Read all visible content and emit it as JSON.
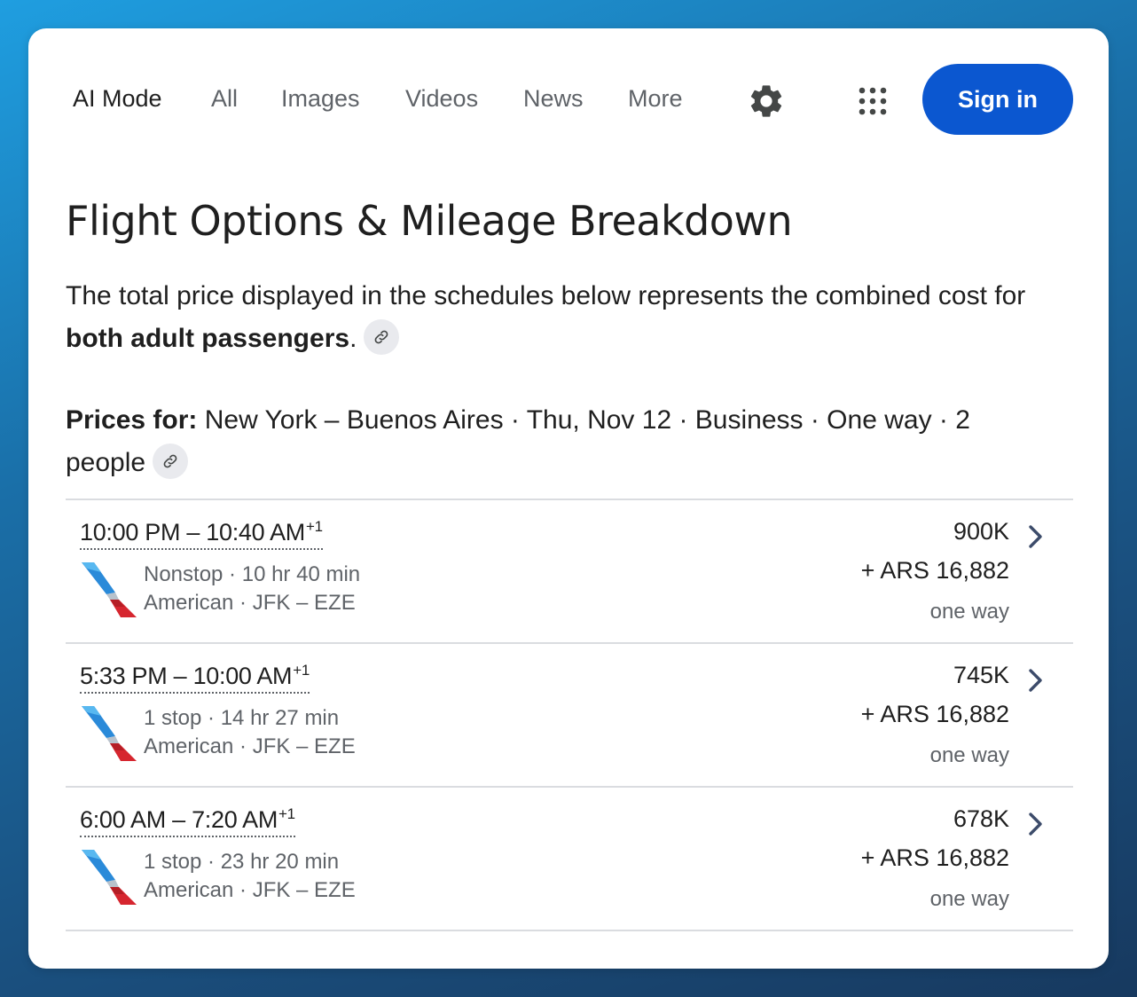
{
  "nav": {
    "items": [
      {
        "label": "AI Mode",
        "active": true
      },
      {
        "label": "All",
        "active": false
      },
      {
        "label": "Images",
        "active": false
      },
      {
        "label": "Videos",
        "active": false
      },
      {
        "label": "News",
        "active": false
      },
      {
        "label": "More",
        "active": false
      }
    ],
    "settings_icon": "gear-icon",
    "apps_icon": "apps-grid-icon",
    "sign_in_label": "Sign in"
  },
  "heading": "Flight Options & Mileage Breakdown",
  "intro": {
    "text_before": "The total price displayed in the schedules below represents the combined cost for ",
    "bold": "both adult passengers",
    "text_after": "."
  },
  "prices_for": {
    "label": "Prices for:",
    "value": " New York – Buenos Aires · Thu, Nov 12 · Business · One way · 2 people"
  },
  "flights": [
    {
      "times": "10:00 PM – 10:40 AM",
      "day_offset": "+1",
      "stops_duration": "Nonstop · 10 hr 40 min",
      "airline_route": "American · JFK – EZE",
      "miles": "900K",
      "fee": "+ ARS 16,882",
      "trip": "one way"
    },
    {
      "times": "5:33 PM – 10:00 AM",
      "day_offset": "+1",
      "stops_duration": "1 stop · 14 hr 27 min",
      "airline_route": "American · JFK – EZE",
      "miles": "745K",
      "fee": "+ ARS 16,882",
      "trip": "one way"
    },
    {
      "times": "6:00 AM – 7:20 AM",
      "day_offset": "+1",
      "stops_duration": "1 stop · 23 hr 20 min",
      "airline_route": "American · JFK – EZE",
      "miles": "678K",
      "fee": "+ ARS 16,882",
      "trip": "one way"
    }
  ],
  "colors": {
    "accent": "#0b57d0",
    "text": "#1f1f1f",
    "muted": "#5f6368",
    "divider": "#dadce0"
  }
}
